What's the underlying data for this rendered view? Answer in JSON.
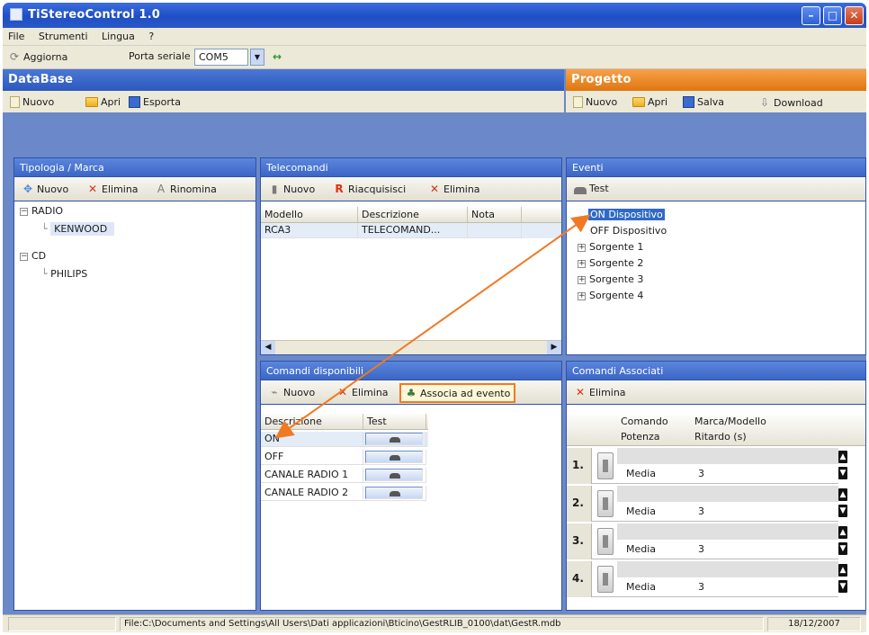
{
  "window": {
    "title": "TiStereoControl 1.0",
    "min": "–",
    "max": "□",
    "close": "✕"
  },
  "menu": [
    "File",
    "Strumenti",
    "Lingua",
    "?"
  ],
  "toolbar": {
    "aggiorna": "Aggiorna",
    "porta_label": "Porta seriale",
    "porta_value": "COM5",
    "connect_icon": "↔"
  },
  "database": {
    "title": "DataBase",
    "buttons": {
      "nuovo": "Nuovo",
      "apri": "Apri",
      "esporta": "Esporta"
    },
    "tipologia": {
      "title": "Tipologia / Marca",
      "buttons": {
        "nuovo": "Nuovo",
        "elimina": "Elimina",
        "rinomina": "Rinomina"
      },
      "tree": [
        {
          "label": "RADIO",
          "children": [
            "KENWOOD"
          ]
        },
        {
          "label": "CD",
          "children": [
            "PHILIPS"
          ]
        }
      ]
    },
    "telecomandi": {
      "title": "Telecomandi",
      "buttons": {
        "nuovo": "Nuovo",
        "riacquisisci": "Riacquisisci",
        "elimina": "Elimina"
      },
      "columns": [
        "Modello",
        "Descrizione",
        "Nota"
      ],
      "rows": [
        {
          "modello": "RCA3",
          "descrizione": "TELECOMAND...",
          "nota": ""
        }
      ]
    },
    "comandi": {
      "title": "Comandi disponibili",
      "buttons": {
        "nuovo": "Nuovo",
        "elimina": "Elimina",
        "associa": "Associa ad evento"
      },
      "columns": [
        "Descrizione",
        "Test"
      ],
      "rows": [
        "ON",
        "OFF",
        "CANALE RADIO 1",
        "CANALE RADIO 2"
      ]
    }
  },
  "progetto": {
    "title": "Progetto",
    "buttons": {
      "nuovo": "Nuovo",
      "apri": "Apri",
      "salva": "Salva",
      "download": "Download"
    },
    "eventi": {
      "title": "Eventi",
      "test": "Test",
      "items": [
        "ON Dispositivo",
        "OFF Dispositivo"
      ],
      "sources": [
        "Sorgente 1",
        "Sorgente 2",
        "Sorgente 3",
        "Sorgente 4"
      ]
    },
    "associati": {
      "title": "Comandi Associati",
      "elimina": "Elimina",
      "columns": {
        "comando": "Comando",
        "marca": "Marca/Modello",
        "potenza": "Potenza",
        "ritardo": "Ritardo (s)"
      },
      "rows": [
        {
          "num": "1.",
          "potenza": "Media",
          "ritardo": "3"
        },
        {
          "num": "2.",
          "potenza": "Media",
          "ritardo": "3"
        },
        {
          "num": "3.",
          "potenza": "Media",
          "ritardo": "3"
        },
        {
          "num": "4.",
          "potenza": "Media",
          "ritardo": "3"
        }
      ]
    }
  },
  "status": {
    "file": "File:C:\\Documents and Settings\\All Users\\Dati applicazioni\\Bticino\\GestRLIB_0100\\dat\\GestR.mdb",
    "date": "18/12/2007"
  },
  "colors": {
    "accent_blue": "#3c66c6",
    "accent_orange": "#e0760f",
    "highlight": "#f07a23"
  }
}
